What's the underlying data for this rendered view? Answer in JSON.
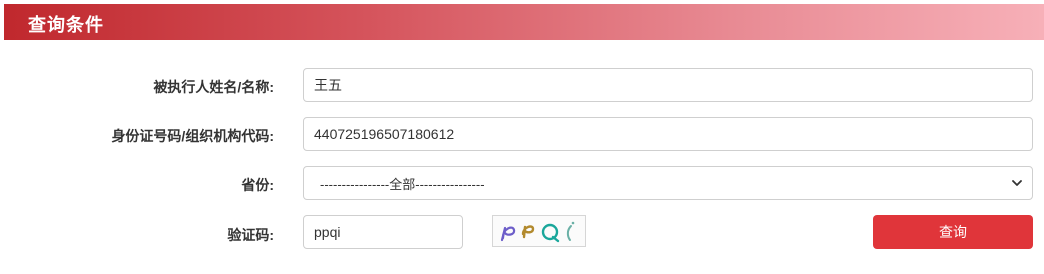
{
  "header": {
    "title": "查询条件"
  },
  "form": {
    "name_label": "被执行人姓名/名称:",
    "name_value": "王五",
    "id_label": "身份证号码/组织机构代码:",
    "id_value": "440725196507180612",
    "province_label": "省份:",
    "province_selected": "----------------全部----------------",
    "captcha_label": "验证码:",
    "captcha_value": "ppqi",
    "search_button": "查询"
  },
  "colors": {
    "header_start": "#c0282d",
    "header_end": "#f7b0b8",
    "button": "#e0353a"
  }
}
